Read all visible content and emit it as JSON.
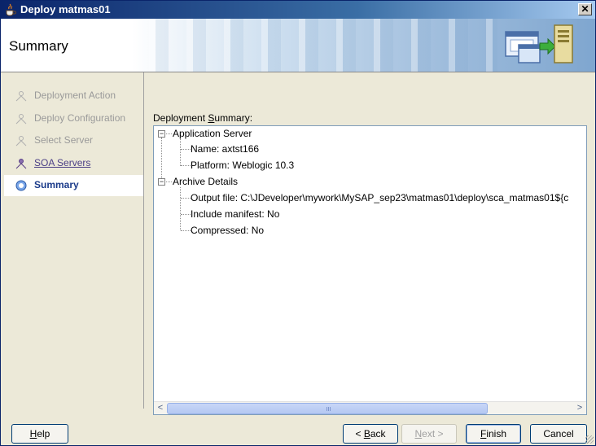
{
  "window": {
    "title": "Deploy matmas01",
    "close_glyph": "✕"
  },
  "header": {
    "page_title": "Summary",
    "banner_art": "computer-server-deploy-graphic"
  },
  "nav": {
    "items": [
      {
        "label": "Deployment Action",
        "state": "completed"
      },
      {
        "label": "Deploy Configuration",
        "state": "completed"
      },
      {
        "label": "Select Server",
        "state": "completed"
      },
      {
        "label": "SOA Servers",
        "state": "link"
      },
      {
        "label": "Summary",
        "state": "active"
      }
    ]
  },
  "summary": {
    "label_prefix": "Deployment ",
    "label_mnemonic": "S",
    "label_suffix": "ummary:",
    "groups": [
      {
        "label": "Application Server",
        "children": [
          "Name: axtst166",
          "Platform: Weblogic 10.3"
        ]
      },
      {
        "label": "Archive Details",
        "children": [
          "Output file: C:\\JDeveloper\\mywork\\MySAP_sep23\\matmas01\\deploy\\sca_matmas01${c",
          "Include manifest: No",
          "Compressed: No"
        ]
      }
    ]
  },
  "buttons": {
    "help": {
      "mn": "H",
      "rest": "elp"
    },
    "back": {
      "pre": "< ",
      "mn": "B",
      "rest": "ack"
    },
    "next": {
      "pre": "",
      "mn": "N",
      "rest": "ext >"
    },
    "finish": {
      "mn": "F",
      "rest": "inish"
    },
    "cancel": "Cancel"
  },
  "icons": {
    "app": "java-cup-icon",
    "tree_collapse": "minus-toggle-icon",
    "scroll_left": "chevron-left-icon",
    "scroll_right": "chevron-right-icon"
  },
  "colors": {
    "title_bar": "#0a246a",
    "nav_active_text": "#1b3b8a",
    "nav_link_text": "#4b3f86",
    "button_border": "#003c74"
  }
}
